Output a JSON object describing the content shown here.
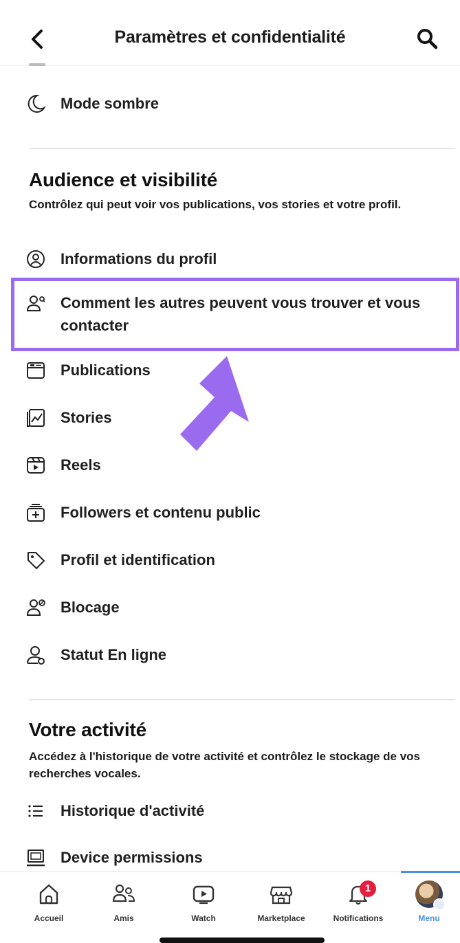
{
  "header": {
    "title": "Paramètres et confidentialité"
  },
  "dark_mode": {
    "label": "Mode sombre"
  },
  "audience": {
    "title": "Audience et visibilité",
    "description": "Contrôlez qui peut voir vos publications, vos stories et votre profil.",
    "items": [
      {
        "label": "Informations du profil",
        "icon": "profile-circle-icon"
      },
      {
        "label": "Comment les autres peuvent vous trouver et vous contacter",
        "icon": "people-search-icon"
      },
      {
        "label": "Publications",
        "icon": "posts-icon"
      },
      {
        "label": "Stories",
        "icon": "stories-icon"
      },
      {
        "label": "Reels",
        "icon": "reels-icon"
      },
      {
        "label": "Followers et contenu public",
        "icon": "followers-icon"
      },
      {
        "label": "Profil et identification",
        "icon": "tag-icon"
      },
      {
        "label": "Blocage",
        "icon": "block-user-icon"
      },
      {
        "label": "Statut En ligne",
        "icon": "online-status-icon"
      }
    ]
  },
  "activity": {
    "title": "Votre activité",
    "description": "Accédez à l'historique de votre activité et contrôlez le stockage de vos recherches vocales.",
    "items": [
      {
        "label": "Historique d'activité",
        "icon": "list-icon"
      },
      {
        "label": "Device permissions",
        "icon": "device-icon"
      }
    ]
  },
  "tabbar": {
    "tabs": [
      {
        "label": "Accueil",
        "icon": "home-icon"
      },
      {
        "label": "Amis",
        "icon": "friends-icon"
      },
      {
        "label": "Watch",
        "icon": "watch-icon"
      },
      {
        "label": "Marketplace",
        "icon": "marketplace-icon"
      },
      {
        "label": "Notifications",
        "icon": "bell-icon",
        "badge": "1"
      },
      {
        "label": "Menu",
        "icon": "avatar",
        "active": true
      }
    ]
  },
  "colors": {
    "highlight": "#9b6bef",
    "active_tab": "#4a90e2",
    "badge": "#e41e3f"
  }
}
